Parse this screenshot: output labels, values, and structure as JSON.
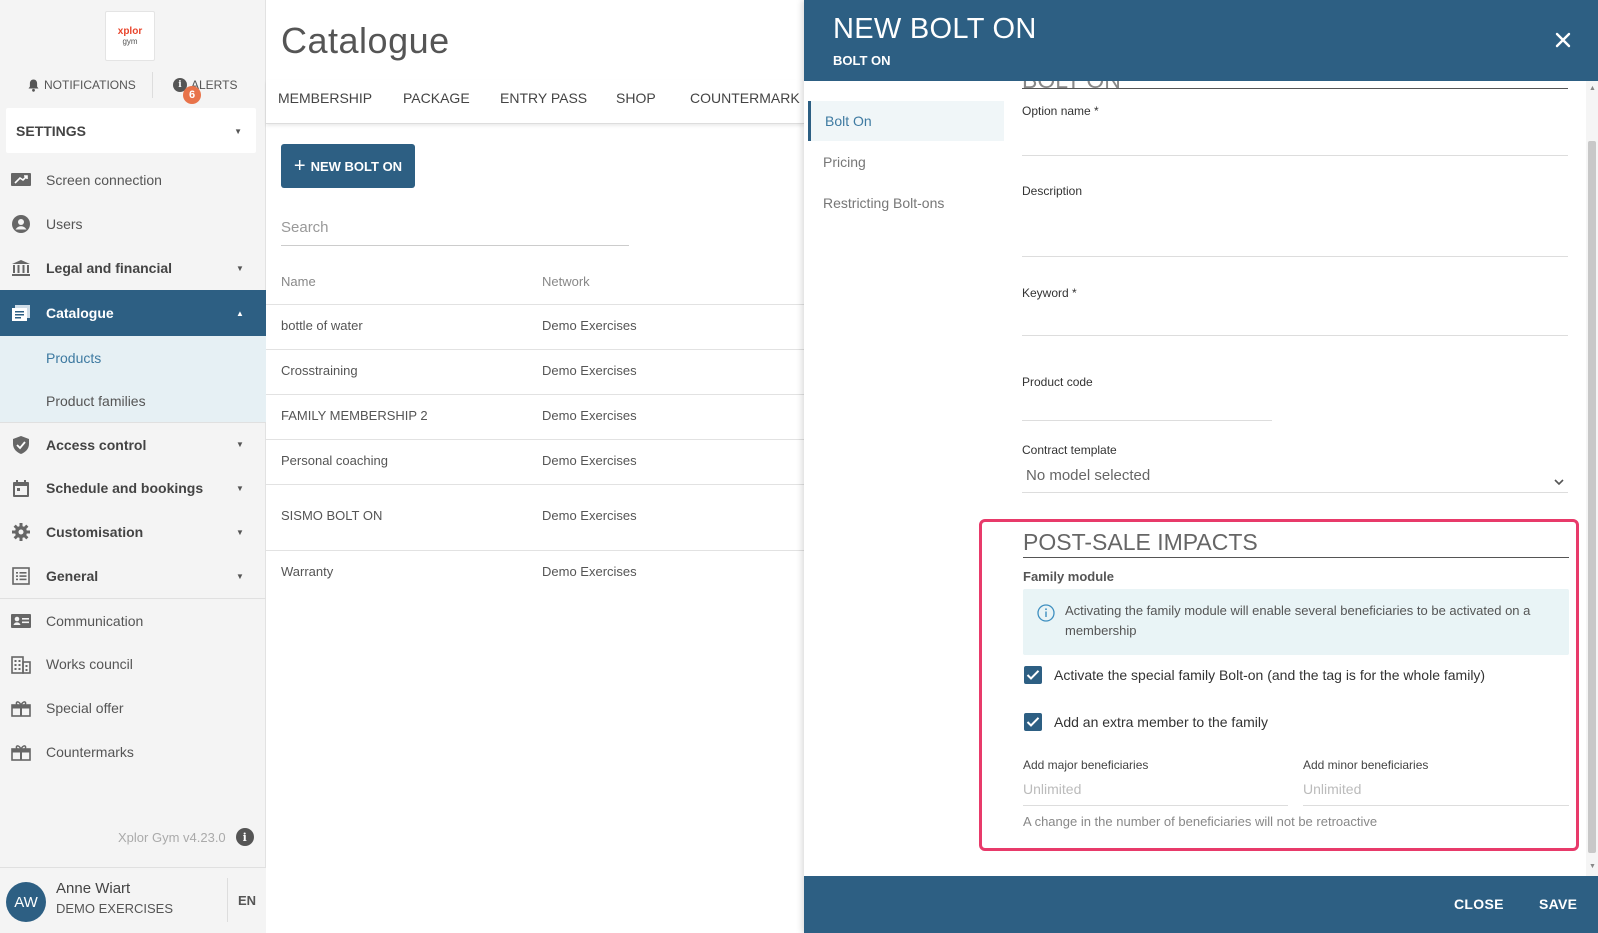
{
  "sidebar": {
    "logo": {
      "line1": "xplor",
      "line2": "gym"
    },
    "notifications_label": "NOTIFICATIONS",
    "alerts_label": "ALERTS",
    "alerts_count": "6",
    "settings_label": "SETTINGS",
    "items": [
      {
        "label": "Screen connection",
        "icon": "screen-connection-icon"
      },
      {
        "label": "Users",
        "icon": "user-icon"
      },
      {
        "label": "Legal and financial",
        "icon": "bank-icon"
      },
      {
        "label": "Catalogue",
        "icon": "catalogue-icon"
      },
      {
        "label": "Products"
      },
      {
        "label": "Product families"
      },
      {
        "label": "Access control",
        "icon": "shield-check-icon"
      },
      {
        "label": "Schedule and bookings",
        "icon": "calendar-icon"
      },
      {
        "label": "Customisation",
        "icon": "gear-icon"
      },
      {
        "label": "General",
        "icon": "list-icon"
      },
      {
        "label": "Communication",
        "icon": "contact-card-icon"
      },
      {
        "label": "Works council",
        "icon": "building-icon"
      },
      {
        "label": "Special offer",
        "icon": "gift-icon"
      },
      {
        "label": "Countermarks",
        "icon": "gift-icon"
      }
    ],
    "version": "Xplor Gym v4.23.0",
    "user": {
      "initials": "AW",
      "name": "Anne Wiart",
      "org": "DEMO EXERCISES",
      "lang": "EN"
    }
  },
  "main": {
    "title": "Catalogue",
    "tabs": [
      "MEMBERSHIP",
      "PACKAGE",
      "ENTRY PASS",
      "SHOP",
      "COUNTERMARK"
    ],
    "new_button": "NEW BOLT ON",
    "search_placeholder": "Search",
    "columns": [
      "Name",
      "Network"
    ],
    "rows": [
      {
        "name": "bottle of water",
        "network": "Demo Exercises"
      },
      {
        "name": "Crosstraining",
        "network": "Demo Exercises"
      },
      {
        "name": "FAMILY MEMBERSHIP 2",
        "network": "Demo Exercises"
      },
      {
        "name": "Personal coaching",
        "network": "Demo Exercises"
      },
      {
        "name": "SISMO BOLT ON",
        "network": "Demo Exercises"
      },
      {
        "name": "Warranty",
        "network": "Demo Exercises"
      }
    ]
  },
  "drawer": {
    "title": "NEW BOLT ON",
    "subtitle": "BOLT ON",
    "nav": [
      "Bolt On",
      "Pricing",
      "Restricting Bolt-ons"
    ],
    "section_heading_cut": "BOLT ON",
    "fields": {
      "option_name": "Option name *",
      "description": "Description",
      "keyword": "Keyword *",
      "product_code": "Product code",
      "contract_template": "Contract template",
      "contract_template_value": "No model selected"
    },
    "post_sale": {
      "title": "POST-SALE IMPACTS",
      "family_module": "Family module",
      "info": "Activating the family module will enable several beneficiaries to be activated on a membership",
      "checkbox1": "Activate the special family Bolt-on (and the tag is for the whole family)",
      "checkbox2": "Add an extra member to the family",
      "major_label": "Add major beneficiaries",
      "minor_label": "Add minor beneficiaries",
      "major_placeholder": "Unlimited",
      "minor_placeholder": "Unlimited",
      "note": "A change in the number of beneficiaries will not be retroactive"
    },
    "footer": {
      "close": "CLOSE",
      "save": "SAVE"
    }
  },
  "colors": {
    "primary": "#2d5f83",
    "highlight": "#e83a6a",
    "badge": "#e8734a"
  }
}
